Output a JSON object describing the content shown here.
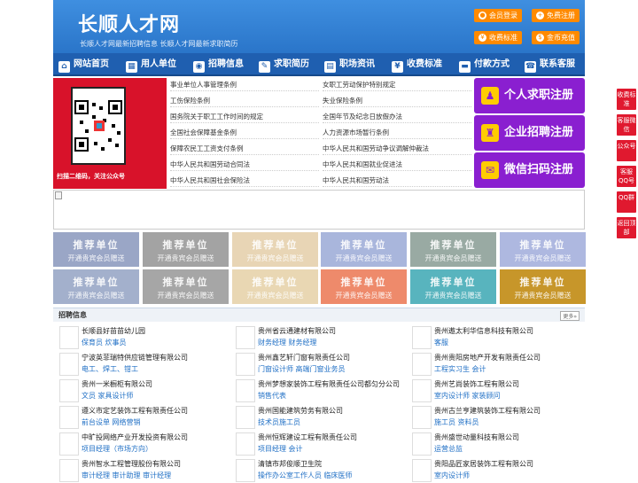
{
  "header": {
    "logo": "长顺人才网",
    "subtitle": "长顺人才网最新招聘信息   长顺人才网最新求职简历",
    "buttons": [
      {
        "label": "会员登录",
        "icon": "user-icon"
      },
      {
        "label": "免费注册",
        "icon": "register-icon"
      },
      {
        "label": "收费标准",
        "icon": "price-icon"
      },
      {
        "label": "金币充值",
        "icon": "coin-icon"
      }
    ]
  },
  "nav": [
    {
      "label": "网站首页",
      "icon": "home-icon"
    },
    {
      "label": "用人单位",
      "icon": "building-icon"
    },
    {
      "label": "招聘信息",
      "icon": "recruit-icon"
    },
    {
      "label": "求职简历",
      "icon": "resume-icon"
    },
    {
      "label": "职场资讯",
      "icon": "news-icon"
    },
    {
      "label": "收费标准",
      "icon": "fee-icon"
    },
    {
      "label": "付款方式",
      "icon": "payment-icon"
    },
    {
      "label": "联系客服",
      "icon": "service-icon"
    }
  ],
  "qr": {
    "caption": "扫描二维码，关注公众号"
  },
  "laws": [
    "事业单位人事管理条例",
    "女职工劳动保护特别规定",
    "工伤保险条例",
    "失业保险条例",
    "国务院关于职工工作时间的规定",
    "全国年节及纪念日放假办法",
    "全国社会保障基金条例",
    "人力资源市场暂行条例",
    "保障农民工工资支付条例",
    "中华人民共和国劳动争议调解仲裁法",
    "中华人民共和国劳动合同法",
    "中华人民共和国就业促进法",
    "中华人民共和国社会保险法",
    "中华人民共和国劳动法"
  ],
  "register": [
    {
      "label": "个人求职注册"
    },
    {
      "label": "企业招聘注册"
    },
    {
      "label": "微信扫码注册"
    }
  ],
  "tiles": {
    "title": "推荐单位",
    "subtitle": "开通贵宾会员赠送",
    "colors": [
      "#9aa6c6",
      "#a3a3a3",
      "#e8d5b5",
      "#a9b6dc",
      "#99aaa3",
      "#aeb8e0",
      "#a3b0cc",
      "#a6a6a6",
      "#e9d7b3",
      "#ee8a6b",
      "#58b4be",
      "#c7962a"
    ]
  },
  "jobs": {
    "title": "招聘信息",
    "more": "更多»",
    "rows": [
      [
        {
          "company": "长顺县好苗苗幼儿园",
          "positions": "保育员 炊事员"
        },
        {
          "company": "贵州省云通建材有限公司",
          "positions": "财务经理 财务经理"
        },
        {
          "company": "贵州遨太利华信息科技有限公司",
          "positions": "客服"
        }
      ],
      [
        {
          "company": "宁波英菲瑞特供应链管理有限公司",
          "positions": "电工、焊工、钳工"
        },
        {
          "company": "贵州鑫艺轩门窗有限责任公司",
          "positions": "门窗设计师 高端门窗业务员"
        },
        {
          "company": "贵州贵阳房地产开发有限责任公司",
          "positions": "工程实习生 会计"
        }
      ],
      [
        {
          "company": "贵州一米橱柜有限公司",
          "positions": "文员 家具设计师"
        },
        {
          "company": "贵州梦想家装饰工程有限责任公司都匀分公司",
          "positions": "销售代表"
        },
        {
          "company": "贵州艺尚装饰工程有限公司",
          "positions": "室内设计师 家装顾问"
        }
      ],
      [
        {
          "company": "遵义市定艺装饰工程有限责任公司",
          "positions": "前台设单 网络营销"
        },
        {
          "company": "贵州国能建筑劳务有限公司",
          "positions": "技术员施工员"
        },
        {
          "company": "贵州古兰亨建筑装饰工程有限公司",
          "positions": "施工员 资料员"
        }
      ],
      [
        {
          "company": "中旷投网络产业开发投资有限公司",
          "positions": "项目经理（市场方向）"
        },
        {
          "company": "贵州恒辉建设工程有限责任公司",
          "positions": "项目经理 会计"
        },
        {
          "company": "贵州盛世动量科技有限公司",
          "positions": "运营总监"
        }
      ],
      [
        {
          "company": "贵州智水工程管理股份有限公司",
          "positions": "审计经理 审计助理 审计经理"
        },
        {
          "company": "清镇市邦俊顺卫生院",
          "positions": "操作办公室工作人员 临床医师"
        },
        {
          "company": "贵阳品匠家居装饰工程有限公司",
          "positions": "室内设计师"
        }
      ]
    ]
  },
  "sidebar": [
    {
      "label": "收费标准"
    },
    {
      "label": "客服微信"
    },
    {
      "label": "公众号"
    },
    {
      "label": "客服QQ号"
    },
    {
      "label": "QQ群"
    },
    {
      "label": "返回顶部"
    }
  ]
}
